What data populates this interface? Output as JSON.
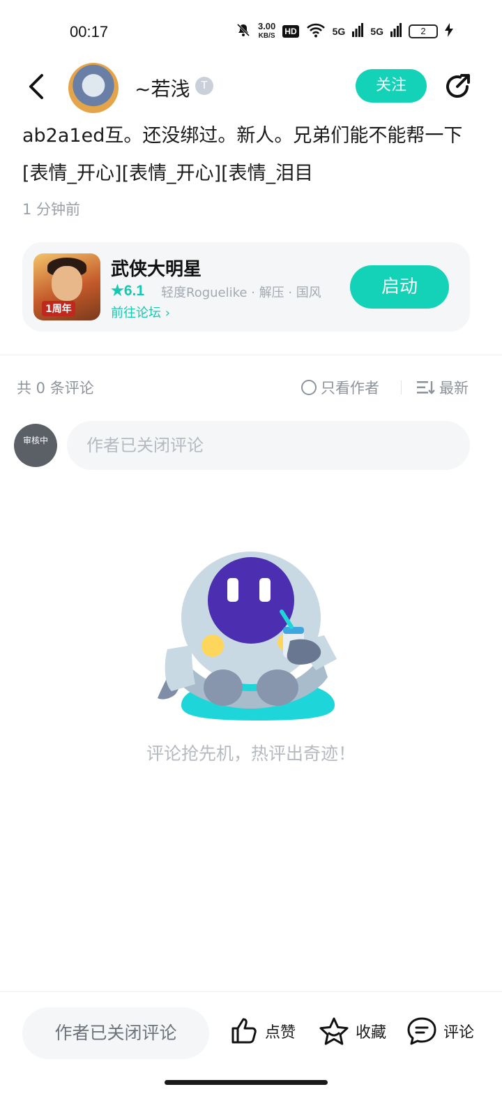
{
  "status_bar": {
    "time": "00:17",
    "net_speed_value": "3.00",
    "net_speed_unit": "KB/S",
    "hd_label": "HD",
    "signal1": "5G",
    "signal2": "5G",
    "battery": "2"
  },
  "header": {
    "username": "~若浅",
    "level_badge": "T",
    "follow_label": "关注"
  },
  "post": {
    "text": "ab2a1ed互。还没绑过。新人。兄弟们能不能帮一下[表情_开心][表情_开心][表情_泪目",
    "time": "1 分钟前"
  },
  "game_card": {
    "title": "武侠大明星",
    "rating": "★6.1",
    "tags": "轻度Roguelike · 解压 · 国风",
    "forum_link": "前往论坛 ›",
    "icon_tag": "1周年",
    "launch_label": "启动"
  },
  "comments": {
    "count_label": "共 0 条评论",
    "author_only_label": "只看作者",
    "sort_label": "最新",
    "avatar_label": "审核中",
    "input_placeholder": "作者已关闭评论",
    "empty_text": "评论抢先机，热评出奇迹！"
  },
  "bottom_bar": {
    "input_label": "作者已关闭评论",
    "like_label": "点赞",
    "favorite_label": "收藏",
    "comment_label": "评论"
  },
  "colors": {
    "accent": "#14d2b8",
    "muted_text": "#9aa0a8",
    "card_bg": "#f4f6f8"
  }
}
